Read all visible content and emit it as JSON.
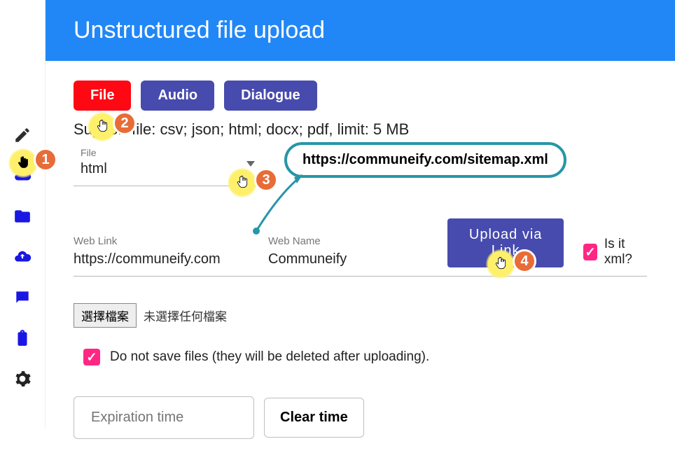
{
  "header": {
    "title": "Unstructured file upload"
  },
  "tabs": {
    "file": "File",
    "audio": "Audio",
    "dialogue": "Dialogue"
  },
  "support_text": "Support file: csv; json; html; docx; pdf, limit: 5 MB",
  "file_field": {
    "label": "File",
    "value": "html"
  },
  "callout_url": "https://communeify.com/sitemap.xml",
  "web_link": {
    "label": "Web Link",
    "value": "https://communeify.com"
  },
  "web_name": {
    "label": "Web Name",
    "value": "Communeify"
  },
  "upload_via_link": "Upload via Link",
  "is_xml_label": "Is it xml?",
  "file_picker": {
    "button": "選擇檔案",
    "status": "未選擇任何檔案"
  },
  "no_save_label": "Do not save files (they will be deleted after uploading).",
  "expiration_placeholder": "Expiration time",
  "clear_time": "Clear time",
  "steps": {
    "s1": "1",
    "s2": "2",
    "s3": "3",
    "s4": "4"
  }
}
